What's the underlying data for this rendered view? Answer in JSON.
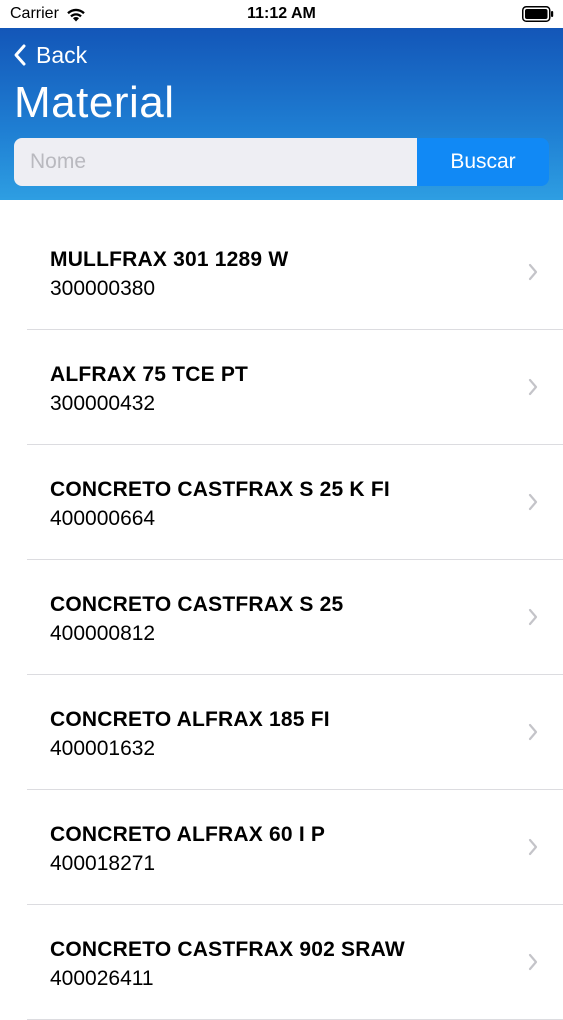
{
  "status_bar": {
    "carrier": "Carrier",
    "time": "11:12 AM"
  },
  "nav": {
    "back_label": "Back",
    "title": "Material"
  },
  "search": {
    "placeholder": "Nome",
    "value": "",
    "button_label": "Buscar"
  },
  "colors": {
    "header_gradient_top": "#1356b8",
    "header_gradient_bottom": "#2e9ee2",
    "search_button": "#1189f5"
  },
  "icons": {
    "back": "chevron-left-icon",
    "row": "chevron-right-icon",
    "wifi": "wifi-icon",
    "battery": "battery-icon"
  },
  "materials": [
    {
      "name": "MULLFRAX 301 1289 W",
      "code": "300000380"
    },
    {
      "name": "ALFRAX 75 TCE PT",
      "code": "300000432"
    },
    {
      "name": "CONCRETO CASTFRAX S 25 K FI",
      "code": "400000664"
    },
    {
      "name": "CONCRETO CASTFRAX S 25",
      "code": "400000812"
    },
    {
      "name": "CONCRETO ALFRAX 185 FI",
      "code": "400001632"
    },
    {
      "name": "CONCRETO ALFRAX 60 I P",
      "code": "400018271"
    },
    {
      "name": "CONCRETO CASTFRAX 902 SRAW",
      "code": "400026411"
    }
  ]
}
